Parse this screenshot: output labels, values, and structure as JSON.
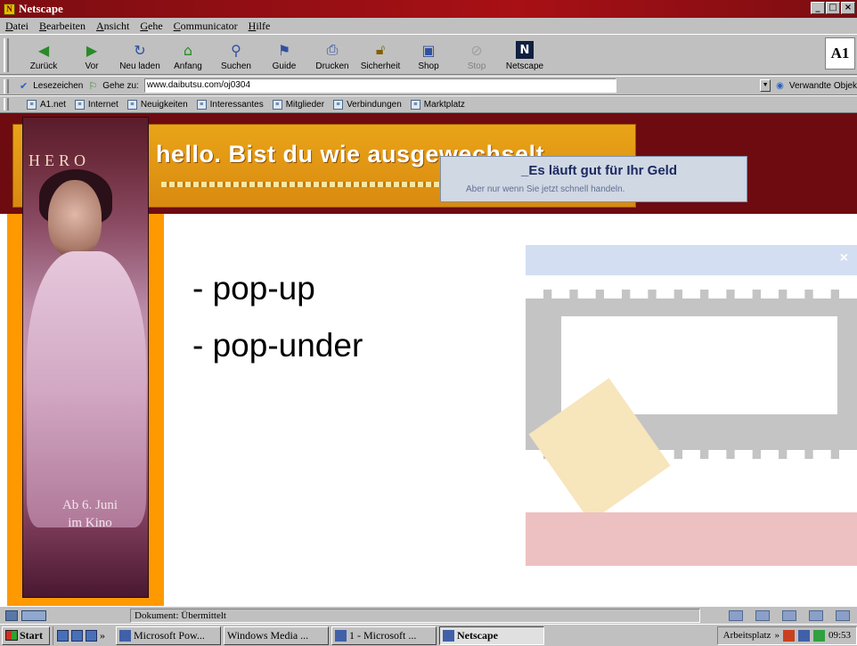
{
  "window": {
    "title": "Netscape",
    "controls": [
      "_",
      "□",
      "×"
    ]
  },
  "menu": [
    "Datei",
    "Bearbeiten",
    "Ansicht",
    "Gehe",
    "Communicator",
    "Hilfe"
  ],
  "toolbar": {
    "buttons": [
      {
        "label": "Zurück",
        "icon": "back-arrow-icon"
      },
      {
        "label": "Vor",
        "icon": "forward-arrow-icon"
      },
      {
        "label": "Neu laden",
        "icon": "reload-icon"
      },
      {
        "label": "Anfang",
        "icon": "home-icon"
      },
      {
        "label": "Suchen",
        "icon": "search-icon"
      },
      {
        "label": "Guide",
        "icon": "guide-icon"
      },
      {
        "label": "Drucken",
        "icon": "print-icon"
      },
      {
        "label": "Sicherheit",
        "icon": "security-lock-icon"
      },
      {
        "label": "Shop",
        "icon": "shop-icon"
      },
      {
        "label": "Stop",
        "icon": "stop-icon",
        "disabled": true
      },
      {
        "label": "Netscape",
        "icon": "netscape-n-icon"
      }
    ],
    "brand": "A1"
  },
  "location": {
    "bookmarks_label": "Lesezeichen",
    "goto_label": "Gehe zu:",
    "url": "www.daibutsu.com/oj0304",
    "related_label": "Verwandte Objek"
  },
  "links": [
    "A1.net",
    "Internet",
    "Neuigkeiten",
    "Interessantes",
    "Mitglieder",
    "Verbindungen",
    "Marktplatz"
  ],
  "page": {
    "banner_text": "hello. Bist du wie ausgewechselt.",
    "popup_title": "_Es läuft gut für Ihr Geld",
    "popup_sub": "Aber nur wenn Sie jetzt schnell handeln.",
    "poster_title": "HERO",
    "poster_date_1": "Ab 6. Juni",
    "poster_date_2": "im Kino",
    "bullet_1": "- pop-up",
    "bullet_2": "- pop-under"
  },
  "status": {
    "text": "Dokument: Übermittelt"
  },
  "taskbar": {
    "start": "Start",
    "tasks": [
      {
        "label": "Microsoft Pow...",
        "active": false
      },
      {
        "label": "Windows Media ...",
        "active": false
      },
      {
        "label": "1 - Microsoft ...",
        "active": false
      },
      {
        "label": "Netscape",
        "active": true
      }
    ],
    "arbeitsplatz": "Arbeitsplatz",
    "clock": "09:53"
  }
}
